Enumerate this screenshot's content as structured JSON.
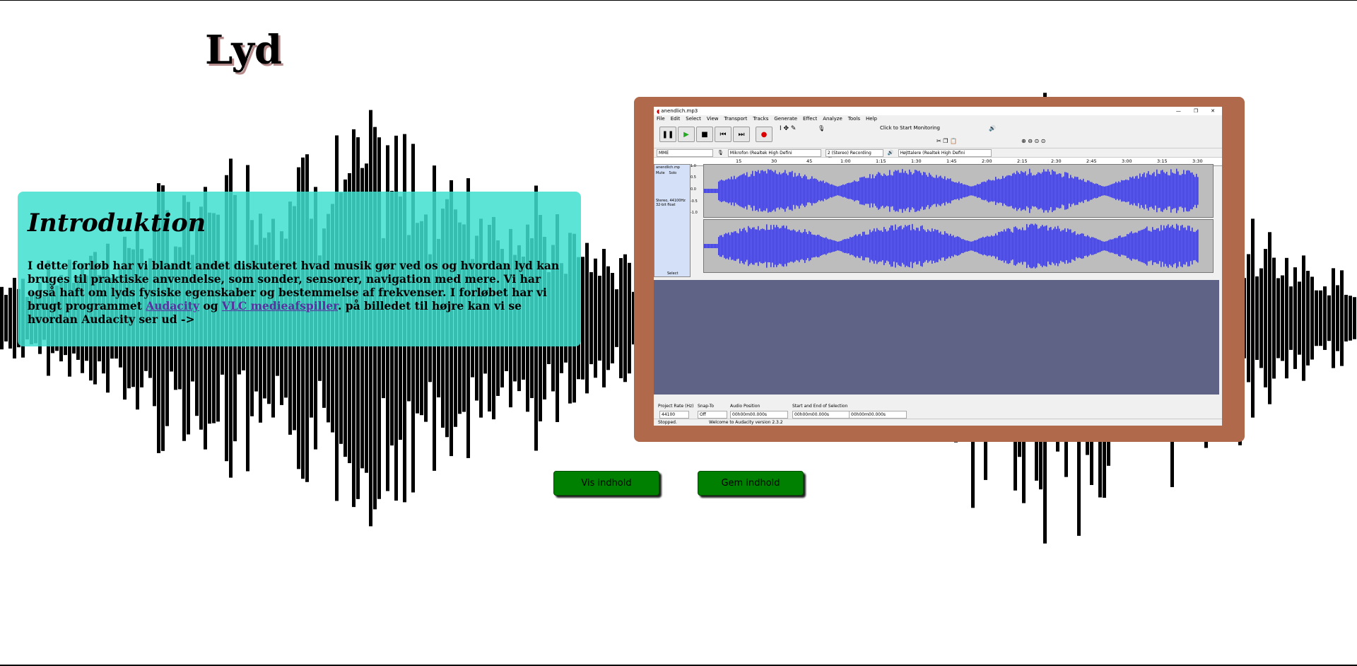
{
  "page": {
    "title": "Lyd"
  },
  "intro": {
    "heading": "Introduktion",
    "text_before": "I dette forløb har vi blandt andet diskuteret hvad musik gør ved os og hvordan lyd kan bruges til praktiske anvendelse, som sonder, sensorer, navigation med mere. Vi har også haft om lyds fysiske egenskaber og bestemmelse af frekvenser. I forløbet har vi brugt programmet ",
    "link_audacity": "Audacity",
    "and_word": " og ",
    "link_vlc": "VLC medieafspiller",
    "text_after": ". på billedet til højre kan vi se hvordan Audacity ser ud ->"
  },
  "audacity": {
    "window_title": "anendlich.mp3",
    "menu": [
      "File",
      "Edit",
      "Select",
      "View",
      "Transport",
      "Tracks",
      "Generate",
      "Effect",
      "Analyze",
      "Tools",
      "Help"
    ],
    "monitor_hint": "Click to Start Monitoring",
    "meter_scale": [
      "-54",
      "-48",
      "-42",
      "-18",
      "-12",
      "-6",
      "0"
    ],
    "devices": {
      "host": "MME",
      "mic": "Mikrofon (Realtek High Defini",
      "channels": "2 (Stereo) Recording Chan",
      "speaker": "Højttalere (Realtek High Defini"
    },
    "timeline_ticks": [
      "15",
      "30",
      "45",
      "1:00",
      "1:15",
      "1:30",
      "1:45",
      "2:00",
      "2:15",
      "2:30",
      "2:45",
      "3:00",
      "3:15",
      "3:30"
    ],
    "track": {
      "name": "anendlich.mp",
      "mute": "Mute",
      "solo": "Solo",
      "info_rate": "Stereo, 44100Hz",
      "info_format": "32-bit float",
      "select": "Select",
      "scale": [
        "1.0",
        "0.5",
        "0.0",
        "-0.5",
        "-1.0"
      ]
    },
    "bottom": {
      "project_rate_label": "Project Rate (Hz)",
      "project_rate_value": "44100",
      "snap_label": "Snap-To",
      "snap_value": "Off",
      "audio_pos_label": "Audio Position",
      "selection_label": "Start and End of Selection",
      "time_value": "00h00m00.000s"
    },
    "status": {
      "state": "Stopped.",
      "message": "Welcome to Audacity version 2.3.2"
    }
  },
  "buttons": {
    "show": "Vis indhold",
    "hide": "Gem indhold"
  },
  "colors": {
    "intro_bg": "#40e0d0",
    "frame": "#b0694a",
    "button": "#008000",
    "wave": "#3a3ad0",
    "empty_track": "#5f6385"
  }
}
